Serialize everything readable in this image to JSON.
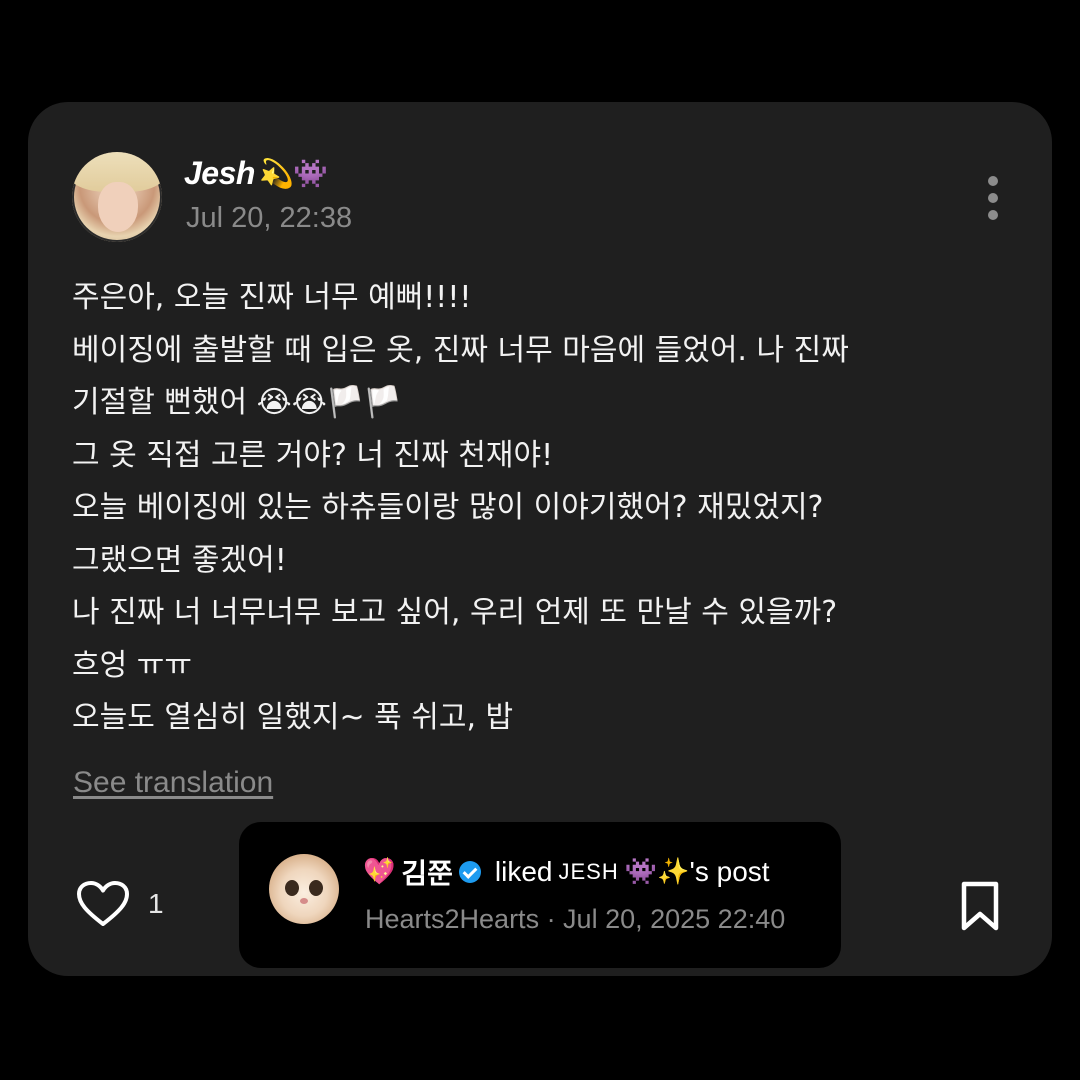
{
  "post": {
    "author": {
      "name": "Jesh",
      "name_emojis": "💫👾"
    },
    "timestamp": "Jul 20, 22:38",
    "body_lines": [
      "주은아, 오늘 진짜 너무 예뻐!!!!",
      "베이징에 출발할 때 입은 옷, 진짜 너무 마음에 들었어. 나 진짜",
      "기절할 뻔했어 😭😭🏳️🏳️",
      "그 옷 직접 고른 거야? 너 진짜 천재야!",
      "오늘 베이징에 있는 하츄들이랑 많이 이야기했어? 재밌었지?",
      "그랬으면 좋겠어!",
      "나 진짜 너 너무너무 보고 싶어, 우리 언제 또 만날 수 있을까?",
      "흐엉 ㅠㅠ",
      "오늘도 열심히 일했지~ 푹 쉬고, 밥"
    ],
    "see_translation": "See translation",
    "like_count": "1"
  },
  "toast": {
    "actor_emoji": "💖",
    "actor": "김쭌",
    "action": "liked",
    "target": "JESH",
    "target_emojis": "👾✨",
    "suffix": "'s post",
    "subtitle": "Hearts2Hearts · Jul 20, 2025 22:40"
  },
  "icons": {
    "more": "more-vertical-icon",
    "like": "heart-icon",
    "bookmark": "bookmark-icon",
    "verified": "verified-badge-icon"
  },
  "colors": {
    "background": "#000000",
    "card": "#1f1f1f",
    "text": "#f2f2f2",
    "muted": "#8a8a8a",
    "verified": "#1d9bf0"
  }
}
